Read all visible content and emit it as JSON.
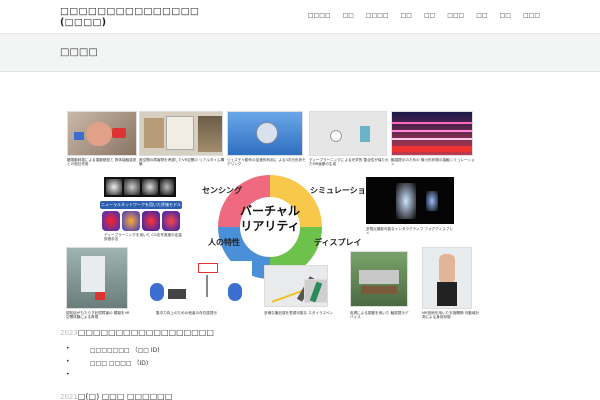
{
  "header": {
    "site_title": "□□□□□□□□□□□□□□□ (□□□□)",
    "nav": [
      "□□□□",
      "□□",
      "□□□□",
      "□□",
      "□□",
      "□□□",
      "□□",
      "□□",
      "□□□"
    ]
  },
  "page": {
    "title": "□□□□"
  },
  "figure": {
    "wheel": {
      "sensing": "センシング",
      "simulation": "シミュレーション",
      "human": "人の特性",
      "display": "ディスプレイ",
      "center_line1": "バーチャル",
      "center_line2": "リアリティ"
    },
    "captions": {
      "c1": "腱振動刺激による運動錯覚と 物体接触感覚との相互作用",
      "c2": "実空間の障害物を考慮したVR空間の リアルタイム構築",
      "c3": "ジェスチャ動作の加速的利用に よる3次元形状モデリング",
      "c4": "ディープラーニングによる光学的 整合性が保たれたMR画像の生成",
      "c5": "触感提示のための 微小形状物の接触シミュレーション",
      "c6": "ディープラーニングを用いた CG法写実度の定量評価手法",
      "c7": "多視点撮影可能なインタラクティブ フォグディスプレイ",
      "c8": "認知症がもたらす記憶障害の 模擬をVR空間体験による再現",
      "c9": "集中力向上のための他者の存在感提示",
      "c10": "多様な筆記感を表現可能な スタイラスペン",
      "c11": "皮膚による振動を用いた 触感提示デバイス",
      "c12": "MR技術を用いた手指関節 可動域計測による身体評価"
    },
    "dnn_label": "ニューラルネットワークを用いた評価モデル"
  },
  "news": {
    "section1_year": "2023",
    "section1_title": "□□□□□□□□□□□□□□□□□□",
    "items": [
      "□□□□□□□ （□□ ID)",
      "□□□ □□□□ （ID)",
      ""
    ],
    "section2_year": "2021",
    "section2_title": "□(□) □□□ □□□□□□"
  },
  "colors": {
    "sensing": "#f06a7f",
    "simulation": "#f7c84a",
    "display": "#6cc24a",
    "human": "#4a90d9"
  }
}
